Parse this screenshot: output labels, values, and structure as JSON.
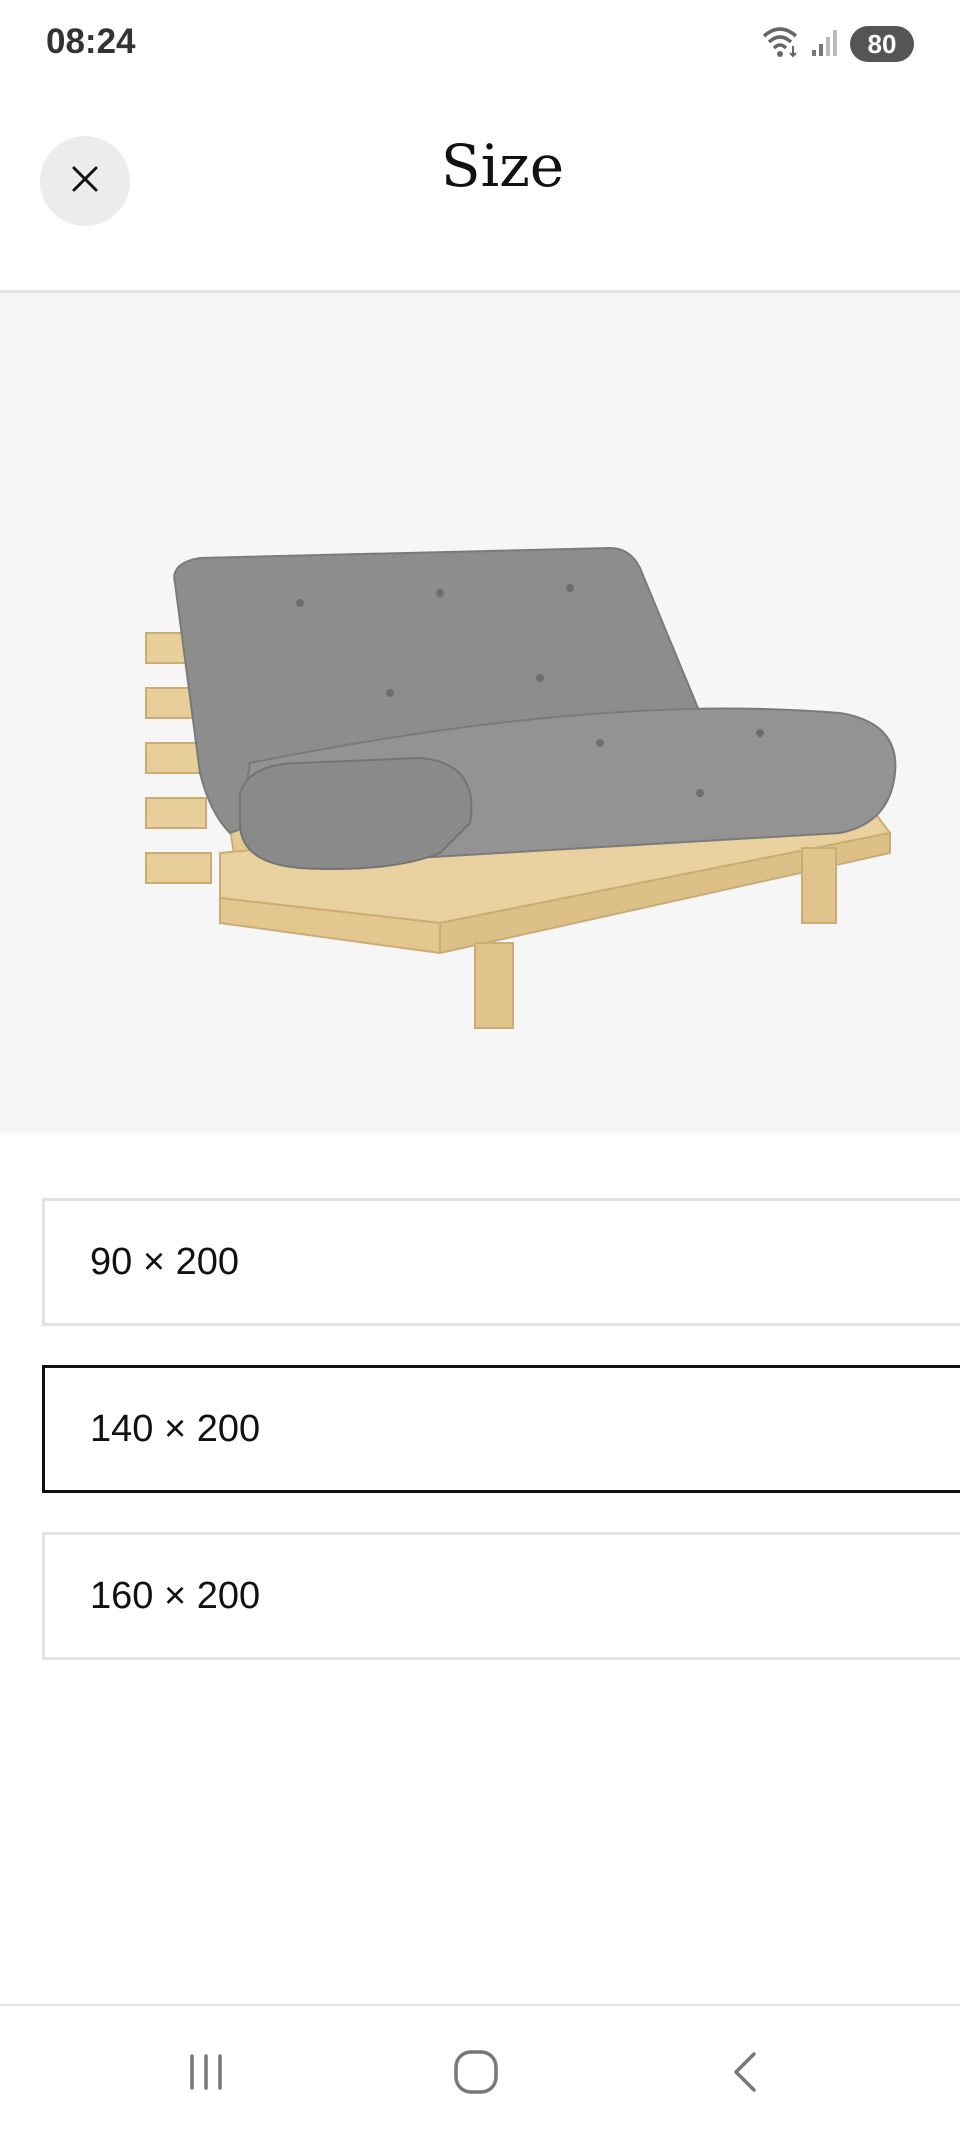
{
  "status_bar": {
    "time": "08:24",
    "battery": "80",
    "icons": [
      "wifi-icon",
      "signal-icon",
      "battery-icon"
    ]
  },
  "header": {
    "title": "Size",
    "close_icon": "close-icon"
  },
  "product": {
    "image_subject": "grey futon sofa on natural pine frame"
  },
  "size_options": [
    {
      "label": "90 × 200",
      "selected": false
    },
    {
      "label": "140 × 200",
      "selected": true
    },
    {
      "label": "160 × 200",
      "selected": false
    }
  ],
  "nav_bar": {
    "icons": [
      "recent-apps-icon",
      "home-icon",
      "back-icon"
    ]
  },
  "colors": {
    "selected_border": "#111111",
    "option_border": "#e2e2e2",
    "image_background": "#f6f6f6",
    "close_button_bg": "#ececec"
  }
}
